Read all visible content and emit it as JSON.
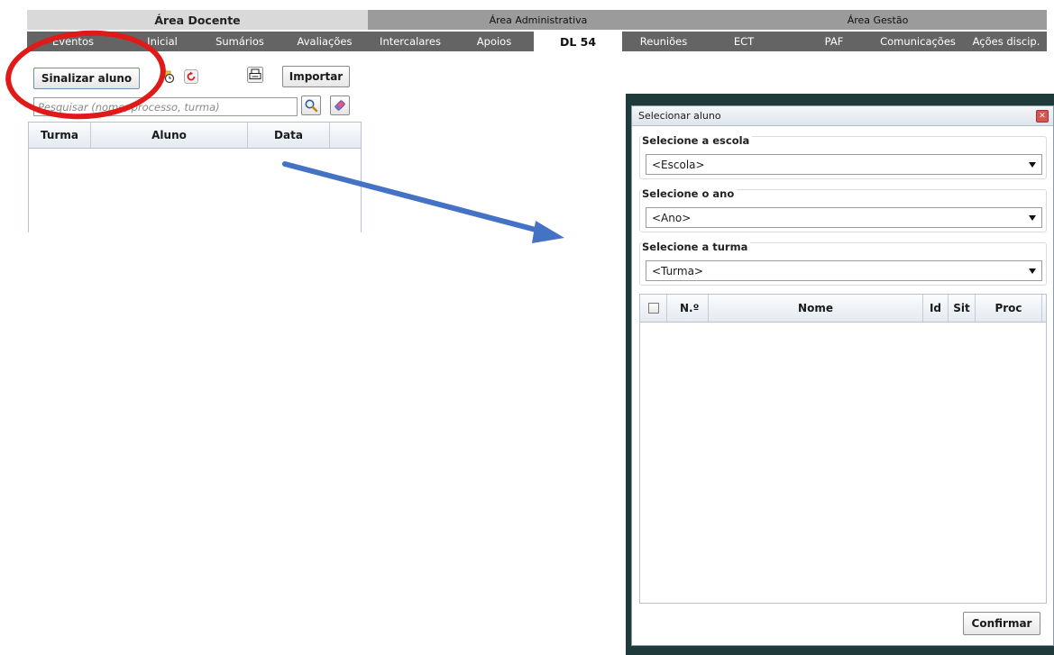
{
  "areas": {
    "docente": "Área Docente",
    "administrativa": "Área Administrativa",
    "gestao": "Área Gestão"
  },
  "tabs": [
    {
      "label": "Eventos",
      "active": false
    },
    {
      "label": "Inicial",
      "active": false
    },
    {
      "label": "Sumários",
      "active": false
    },
    {
      "label": "Avaliações",
      "active": false
    },
    {
      "label": "Intercalares",
      "active": false
    },
    {
      "label": "Apoios",
      "active": false
    },
    {
      "label": "DL 54",
      "active": true
    },
    {
      "label": "Reuniões",
      "active": false
    },
    {
      "label": "ECT",
      "active": false
    },
    {
      "label": "PAF",
      "active": false
    },
    {
      "label": "Comunicações",
      "active": false
    },
    {
      "label": "Ações discip.",
      "active": false
    }
  ],
  "toolbar": {
    "sinalizar_label": "Sinalizar aluno",
    "importar_label": "Importar",
    "search_placeholder": "Pesquisar (nome, processo, turma)"
  },
  "left_grid": {
    "columns": [
      "Turma",
      "Aluno",
      "Data"
    ]
  },
  "dialog": {
    "title": "Selecionar aluno",
    "escola_legend": "Selecione a escola",
    "escola_value": "<Escola>",
    "ano_legend": "Selecione o ano",
    "ano_value": "<Ano>",
    "turma_legend": "Selecione a turma",
    "turma_value": "<Turma>",
    "columns": [
      "N.º",
      "Nome",
      "Id",
      "Sit",
      "Proc"
    ],
    "confirm_label": "Confirmar"
  },
  "colors": {
    "annotation_red": "#e01919",
    "annotation_arrow": "#4472c4",
    "tab_bar": "#646464"
  },
  "icons": [
    "calendar-clock-icon",
    "refresh-icon",
    "print-icon",
    "search-icon",
    "eraser-icon",
    "close-icon",
    "dropdown-arrow-icon"
  ]
}
